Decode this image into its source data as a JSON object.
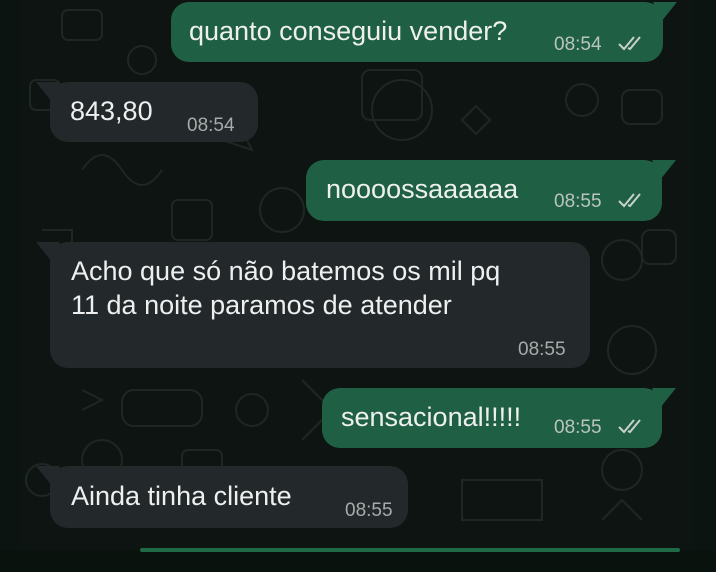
{
  "messages": [
    {
      "direction": "outgoing",
      "text": "quanto conseguiu vender?",
      "time": "08:54",
      "status": "read"
    },
    {
      "direction": "incoming",
      "text": "843,80",
      "time": "08:54"
    },
    {
      "direction": "outgoing",
      "text": "noooossaaaaaa",
      "time": "08:55",
      "status": "read"
    },
    {
      "direction": "incoming",
      "lines": [
        "Acho que só não batemos os mil pq",
        "11 da noite paramos de atender"
      ],
      "time": "08:55"
    },
    {
      "direction": "outgoing",
      "text": "sensacional!!!!!",
      "time": "08:55",
      "status": "read"
    },
    {
      "direction": "incoming",
      "text": "Ainda tinha cliente",
      "time": "08:55"
    }
  ],
  "colors": {
    "outgoing_bubble": "#1f5f43",
    "incoming_bubble": "#23282a",
    "chat_background": "#0e1412"
  },
  "icons": {
    "read_receipt": "double-check-icon"
  }
}
